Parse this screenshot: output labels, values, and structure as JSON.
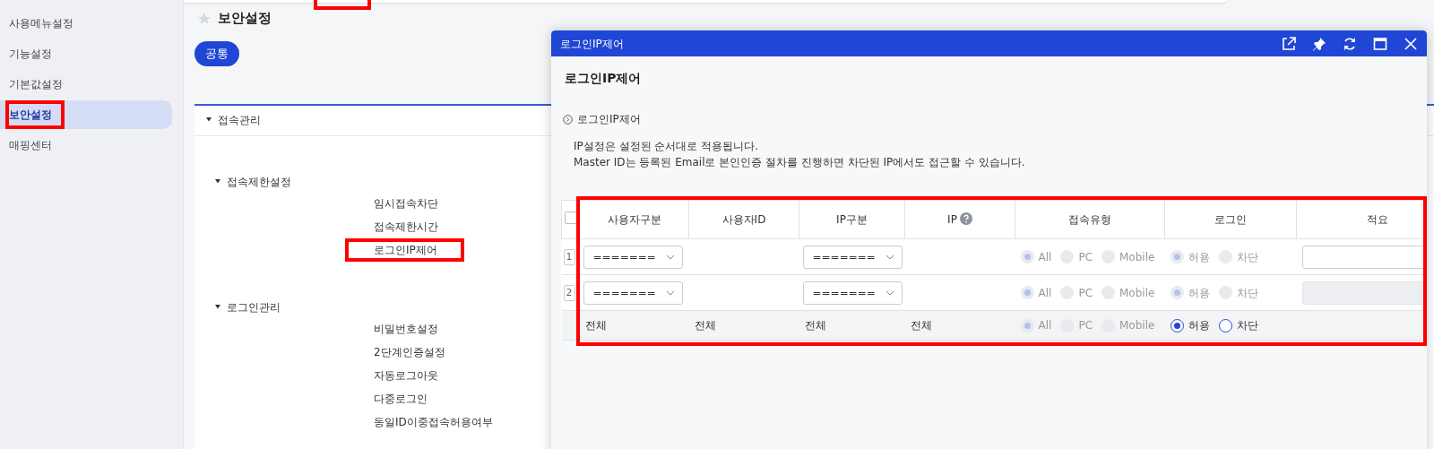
{
  "top_bar": {
    "highlighted": true
  },
  "sidebar": {
    "items": [
      {
        "label": "사용메뉴설정",
        "selected": false,
        "highlighted": false
      },
      {
        "label": "기능설정",
        "selected": false,
        "highlighted": false
      },
      {
        "label": "기본값설정",
        "selected": false,
        "highlighted": false
      },
      {
        "label": "보안설정",
        "selected": true,
        "highlighted": true
      },
      {
        "label": "매핑센터",
        "selected": false,
        "highlighted": false
      }
    ]
  },
  "page": {
    "title": "보안설정",
    "favorite": false,
    "tabs": [
      {
        "label": "공통",
        "selected": true
      }
    ],
    "section": {
      "title": "접속관리",
      "expanded": true,
      "groups": [
        {
          "title": "접속제한설정",
          "expanded": true,
          "children": [
            {
              "label": "임시접속차단",
              "highlighted": false
            },
            {
              "label": "접속제한시간",
              "highlighted": false
            },
            {
              "label": "로그인IP제어",
              "highlighted": true
            }
          ]
        },
        {
          "title": "로그인관리",
          "expanded": true,
          "children": [
            {
              "label": "비밀번호설정",
              "highlighted": false
            },
            {
              "label": "2단계인증설정",
              "highlighted": false
            },
            {
              "label": "자동로그아웃",
              "highlighted": false
            },
            {
              "label": "다중로그인",
              "highlighted": false
            },
            {
              "label": "동일ID이중접속허용여부",
              "highlighted": false
            }
          ]
        }
      ]
    }
  },
  "dialog": {
    "title": "로그인IP제어",
    "heading": "로그인IP제어",
    "section_title": "로그인IP제어",
    "notes": [
      "IP설정은 설정된 순서대로 적용됩니다.",
      "Master ID는 등록된 Email로 본인인증 절차를 진행하면 차단된 IP에서도 접근할 수 있습니다."
    ],
    "table": {
      "highlighted": true,
      "select_all": {
        "checked": false
      },
      "columns": [
        {
          "label": "사용자구분",
          "help": false
        },
        {
          "label": "사용자ID",
          "help": false
        },
        {
          "label": "IP구분",
          "help": false
        },
        {
          "label": "IP",
          "help": true
        },
        {
          "label": "접속유형",
          "help": false
        },
        {
          "label": "로그인",
          "help": false
        },
        {
          "label": "적요",
          "help": false
        }
      ],
      "rows": [
        {
          "kind": "edit",
          "number": "1",
          "user_type": "=======",
          "ip_type": "=======",
          "access_disabled": true,
          "access_options": [
            {
              "label": "All",
              "selected": true
            },
            {
              "label": "PC",
              "selected": false
            },
            {
              "label": "Mobile",
              "selected": false
            }
          ],
          "login_disabled": true,
          "login_options": [
            {
              "label": "허용",
              "selected": true
            },
            {
              "label": "차단",
              "selected": false
            }
          ],
          "memo_disabled": false
        },
        {
          "kind": "edit",
          "number": "2",
          "user_type": "=======",
          "ip_type": "=======",
          "access_disabled": true,
          "access_options": [
            {
              "label": "All",
              "selected": true
            },
            {
              "label": "PC",
              "selected": false
            },
            {
              "label": "Mobile",
              "selected": false
            }
          ],
          "login_disabled": true,
          "login_options": [
            {
              "label": "허용",
              "selected": true
            },
            {
              "label": "차단",
              "selected": false
            }
          ],
          "memo_disabled": true
        },
        {
          "kind": "total",
          "cells": [
            "전체",
            "전체",
            "전체",
            "전체"
          ],
          "access_disabled": true,
          "access_options": [
            {
              "label": "All",
              "selected": true
            },
            {
              "label": "PC",
              "selected": false
            },
            {
              "label": "Mobile",
              "selected": false
            }
          ],
          "login_disabled": false,
          "login_options": [
            {
              "label": "허용",
              "selected": true
            },
            {
              "label": "차단",
              "selected": false
            }
          ]
        }
      ]
    }
  }
}
